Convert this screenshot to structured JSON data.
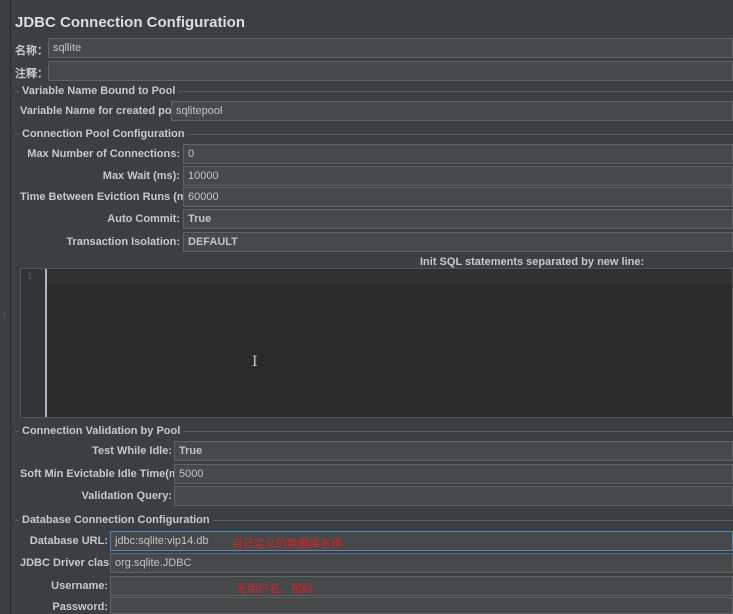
{
  "window": {
    "title": "JDBC Connection Configuration",
    "grip": "⁝"
  },
  "name_row": {
    "label": "名称：",
    "value": "sqllite"
  },
  "comment_row": {
    "label": "注释：",
    "value": ""
  },
  "bound_pool": {
    "title": "Variable Name Bound to Pool",
    "var_label": "Variable Name for created pool:",
    "var_value": "sqlitepool"
  },
  "pool_config": {
    "title": "Connection Pool Configuration",
    "max_conn_label": "Max Number of Connections:",
    "max_conn_value": "0",
    "max_wait_label": "Max Wait (ms):",
    "max_wait_value": "10000",
    "eviction_label": "Time Between Eviction Runs (ms):",
    "eviction_value": "60000",
    "auto_commit_label": "Auto Commit:",
    "auto_commit_value": "True",
    "isolation_label": "Transaction Isolation:",
    "isolation_value": "DEFAULT",
    "init_sql_label": "Init SQL statements separated by new line:",
    "editor_line_number": "1",
    "text_cursor": "I"
  },
  "validation": {
    "title": "Connection Validation by Pool",
    "test_idle_label": "Test While Idle:",
    "test_idle_value": "True",
    "soft_min_label": "Soft Min Evictable Idle Time(ms):",
    "soft_min_value": "5000",
    "query_label": "Validation Query:",
    "query_value": ""
  },
  "db_config": {
    "title": "Database Connection Configuration",
    "url_label": "Database URL:",
    "url_value": "jdbc:sqlite:vip14.db",
    "url_annotation": "自己定义的数据库名称",
    "driver_label": "JDBC Driver class:",
    "driver_value": "org.sqlite.JDBC",
    "username_label": "Username:",
    "username_value": "",
    "username_annotation": "无用户名、密码",
    "password_label": "Password:",
    "password_value": ""
  },
  "colors": {
    "background": "#3c3f41",
    "field": "#45494a",
    "editor": "#2b2b2b",
    "annotation": "#e02020",
    "focus": "#4a88c7"
  }
}
